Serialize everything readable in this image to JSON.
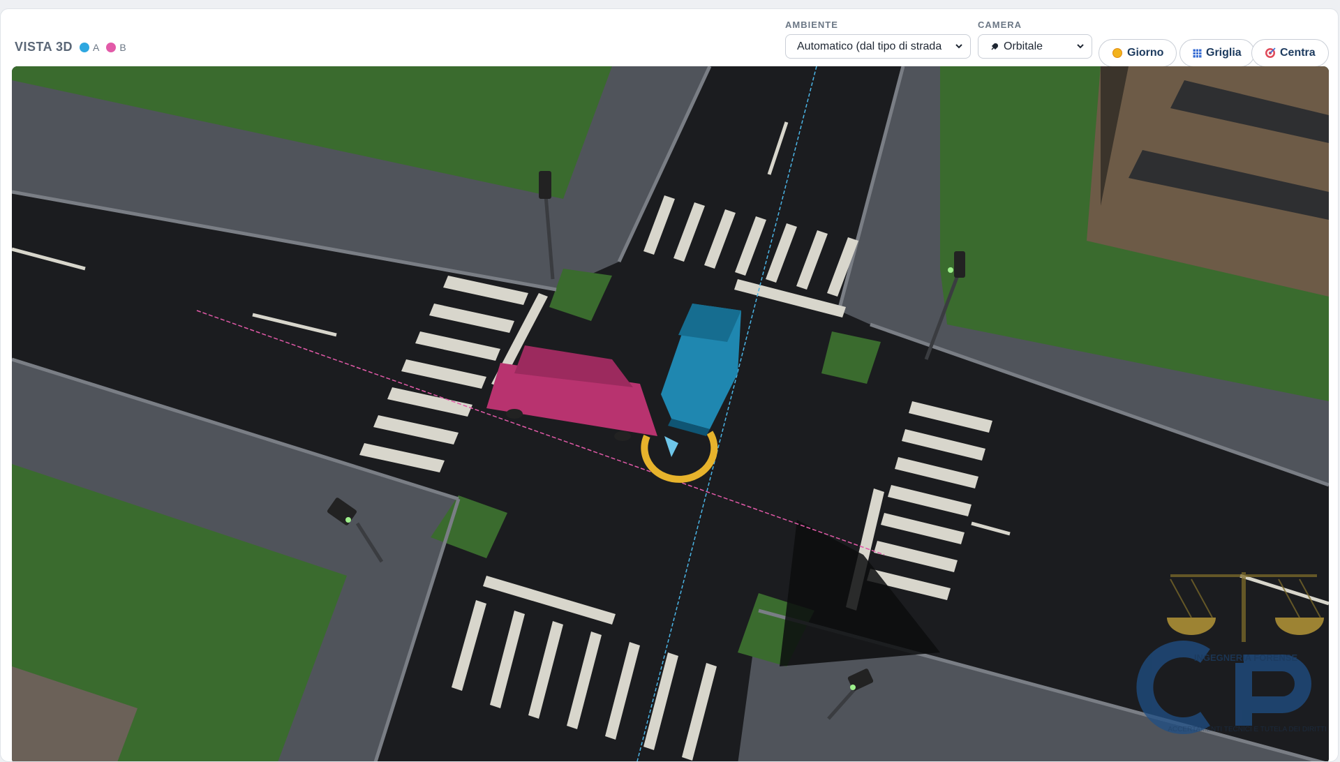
{
  "header": {
    "title": "VISTA 3D",
    "legend": [
      {
        "label": "A",
        "color": "#2ea7e0"
      },
      {
        "label": "B",
        "color": "#e25aa8"
      }
    ]
  },
  "controls": {
    "ambiente": {
      "label": "AMBIENTE",
      "value": "Automatico (dal tipo di strada"
    },
    "camera": {
      "label": "CAMERA",
      "value": "Orbitale",
      "icon": "rocket-icon"
    },
    "buttons": [
      {
        "label": "Giorno",
        "icon": "sun-icon"
      },
      {
        "label": "Griglia",
        "icon": "grid-icon"
      },
      {
        "label": "Centra",
        "icon": "target-icon"
      }
    ]
  },
  "watermark": {
    "text": "INGEGNERIA FORENSE",
    "logo": "CTP",
    "subtext": "ACCERTAMENTI TECNICI E TUTELA DEI DIRITTI"
  },
  "colors": {
    "vehicle_a": "#1f87b0",
    "vehicle_b": "#b8336f",
    "grass": "#3a6b2e",
    "sidewalk": "#50545b",
    "asphalt": "#1b1c1f",
    "impact_ring": "#e7b32c"
  }
}
